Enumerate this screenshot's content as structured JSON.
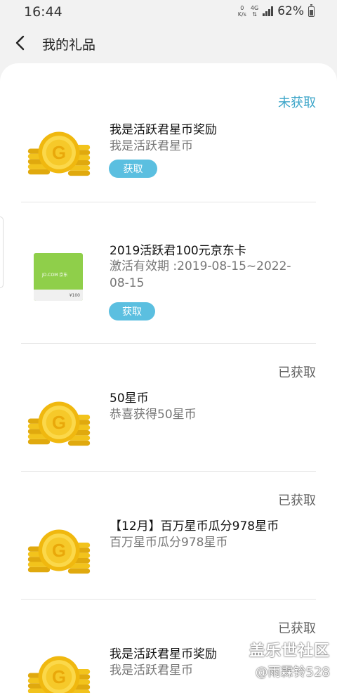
{
  "status_bar": {
    "time": "16:44",
    "net_speed": "0",
    "net_unit": "K/s",
    "network": "4G",
    "battery": "62%"
  },
  "app_bar": {
    "title": "我的礼品",
    "back_icon": "back-arrow-icon"
  },
  "items": [
    {
      "status": "未获取",
      "name": "我是活跃君星币奖励",
      "desc": "我是活跃君星币",
      "button": "获取",
      "thumb": "gold-coin-icon"
    },
    {
      "status": "",
      "name": "2019活跃君100元京东卡",
      "desc": "激活有效期 :2019-08-15~2022-08-15",
      "button": "获取",
      "thumb": "jd-card-icon",
      "card_brand": "JD.COM 京东",
      "card_value": "¥100"
    },
    {
      "status": "已获取",
      "name": "50星币",
      "desc": "恭喜获得50星币",
      "thumb": "gold-coin-icon"
    },
    {
      "status": "已获取",
      "name": "【12月】百万星币瓜分978星币",
      "desc": "百万星币瓜分978星币",
      "thumb": "gold-coin-icon"
    },
    {
      "status": "已获取",
      "name": "我是活跃君星币奖励",
      "desc": "我是活跃君星币",
      "thumb": "gold-coin-icon"
    }
  ],
  "colors": {
    "accent": "#5bbfe0",
    "status_unclaimed": "#3ea6c9",
    "status_claimed": "#666666",
    "coin": "#f2c31c"
  },
  "watermark": {
    "line1": "盖乐世社区",
    "line2": "@雨霖铃528"
  }
}
